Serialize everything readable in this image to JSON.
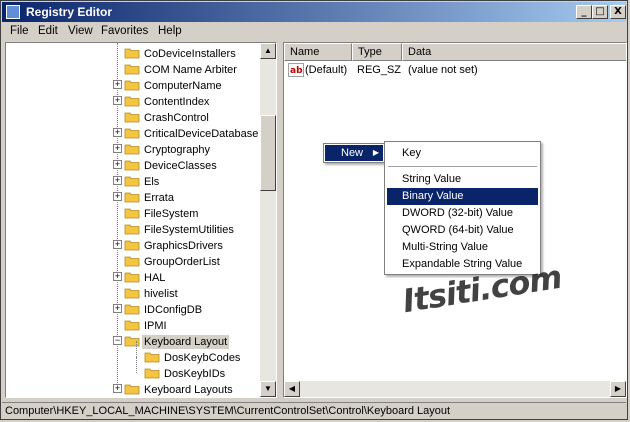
{
  "window": {
    "title": "Registry Editor",
    "min": "_",
    "max": "□",
    "close": "X"
  },
  "menu": [
    "File",
    "Edit",
    "View",
    "Favorites",
    "Help"
  ],
  "tree": [
    {
      "label": "CoDeviceInstallers",
      "expander": false
    },
    {
      "label": "COM Name Arbiter",
      "expander": false
    },
    {
      "label": "ComputerName",
      "expander": true
    },
    {
      "label": "ContentIndex",
      "expander": true
    },
    {
      "label": "CrashControl",
      "expander": false
    },
    {
      "label": "CriticalDeviceDatabase",
      "expander": true
    },
    {
      "label": "Cryptography",
      "expander": true
    },
    {
      "label": "DeviceClasses",
      "expander": true
    },
    {
      "label": "Els",
      "expander": true
    },
    {
      "label": "Errata",
      "expander": true
    },
    {
      "label": "FileSystem",
      "expander": false
    },
    {
      "label": "FileSystemUtilities",
      "expander": false
    },
    {
      "label": "GraphicsDrivers",
      "expander": true
    },
    {
      "label": "GroupOrderList",
      "expander": false
    },
    {
      "label": "HAL",
      "expander": true
    },
    {
      "label": "hivelist",
      "expander": false
    },
    {
      "label": "IDConfigDB",
      "expander": true
    },
    {
      "label": "IPMI",
      "expander": false
    },
    {
      "label": "Keyboard Layout",
      "expander": true,
      "expanded": true,
      "selected": true
    },
    {
      "label": "DosKeybCodes",
      "child": true
    },
    {
      "label": "DosKeybIDs",
      "child": true
    },
    {
      "label": "Keyboard Layouts",
      "expander": true
    }
  ],
  "list": {
    "headers": [
      "Name",
      "Type",
      "Data"
    ],
    "rows": [
      {
        "name": "(Default)",
        "type": "REG_SZ",
        "data": "(value not set)",
        "icon": "ab"
      }
    ]
  },
  "context_menu": {
    "new_label": "New",
    "items": [
      "Key",
      "String Value",
      "Binary Value",
      "DWORD (32-bit) Value",
      "QWORD (64-bit) Value",
      "Multi-String Value",
      "Expandable String Value"
    ],
    "highlighted": "Binary Value"
  },
  "status": "Computer\\HKEY_LOCAL_MACHINE\\SYSTEM\\CurrentControlSet\\Control\\Keyboard Layout",
  "watermark": "Itsiti.com",
  "colors": {
    "title_start": "#0a246a",
    "title_end": "#a6caf0",
    "highlight": "#0a246a",
    "folder": "#f5c542"
  }
}
